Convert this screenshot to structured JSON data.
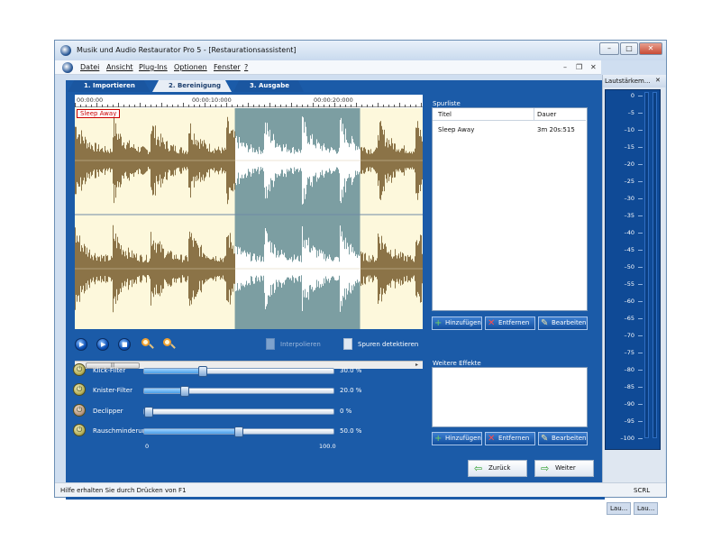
{
  "window": {
    "title": "Musik und Audio Restaurator Pro 5 - [Restaurationsassistent]",
    "controls": [
      "–",
      "□",
      "✕"
    ]
  },
  "menu": {
    "items": [
      "Datei",
      "Ansicht",
      "Plug-Ins",
      "Optionen",
      "Fenster",
      "?"
    ],
    "mdi_controls": [
      "–",
      "❐",
      "✕"
    ]
  },
  "tabs": [
    {
      "label": "1. Importieren",
      "active": false
    },
    {
      "label": "2. Bereinigung",
      "active": true
    },
    {
      "label": "3. Ausgabe",
      "active": false
    }
  ],
  "waveform": {
    "ruler": [
      "00:00:00",
      "00:00:10:000",
      "00:00:20:000"
    ],
    "track_name": "Sleep Away",
    "selection_start": 0.46,
    "selection_end": 0.82
  },
  "transport": {
    "interpolate_label": "Interpolieren",
    "detect_tracks_label": "Spuren detektieren"
  },
  "effects": [
    {
      "label": "Klick-Filter",
      "value_text": "30.0 %",
      "value": 0.3,
      "enabled": true
    },
    {
      "label": "Knister-Filter",
      "value_text": "20.0 %",
      "value": 0.2,
      "enabled": true
    },
    {
      "label": "Declipper",
      "value_text": "0 %",
      "value": 0.0,
      "enabled": false
    },
    {
      "label": "Rauschminderun",
      "value_text": "50.0 %",
      "value": 0.5,
      "enabled": true
    }
  ],
  "slider_scale": {
    "min": "0",
    "max": "100.0"
  },
  "track_list": {
    "label": "Spurliste",
    "columns": [
      "Titel",
      "Dauer"
    ],
    "rows": [
      {
        "title": "Sleep Away",
        "duration": "3m 20s:515"
      }
    ]
  },
  "list_buttons": {
    "add": "Hinzufügen",
    "remove": "Entfernen",
    "edit": "Bearbeiten"
  },
  "more_effects": {
    "label": "Weitere Effekte"
  },
  "nav": {
    "back": "Zurück",
    "next": "Weiter"
  },
  "status": {
    "text": "Hilfe erhalten Sie durch Drücken von F1",
    "scrl": "SCRL"
  },
  "side_panel": {
    "title": "Lautstärkem...",
    "scale": [
      "0",
      "–5",
      "–10",
      "–15",
      "–20",
      "–25",
      "–30",
      "–35",
      "–40",
      "–45",
      "–50",
      "–55",
      "–60",
      "–65",
      "–70",
      "–75",
      "–80",
      "–85",
      "–90",
      "–95",
      "–100"
    ],
    "tabs": [
      "Lau...",
      "Lau..."
    ]
  },
  "colors": {
    "panel_blue": "#1b5ba8",
    "wave_bg": "#fdf8dc",
    "wave_color": "#8b7347",
    "selection": "#7c9ea2",
    "selection_wave": "#ffffff"
  }
}
